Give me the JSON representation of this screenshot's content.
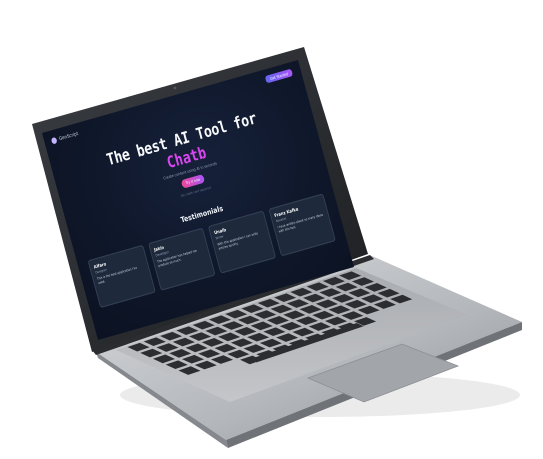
{
  "screen": {
    "nav": {
      "brand": "GenScript",
      "cta_label": "Get Started"
    },
    "hero": {
      "title": "The best AI Tool for",
      "accent": "Chatb",
      "subtitle": "Create content using AI in seconds",
      "button_label": "Try it now",
      "note": "No credit card required"
    },
    "testimonials": {
      "heading": "Testimonials",
      "cards": [
        {
          "name": "Alfaro",
          "role": "Designer",
          "text": "This is the best application I've used."
        },
        {
          "name": "Jakin",
          "role": "Developer",
          "text": "The application has helped me produce so much."
        },
        {
          "name": "Unalb",
          "role": "Writer",
          "text": "With this application I can write articles quickly."
        },
        {
          "name": "Franz Kafka",
          "role": "Novelist",
          "text": "I have written about so many ideas with this tool."
        }
      ]
    }
  },
  "colors": {
    "screen_bg": "#0f172a",
    "accent_pink": "#d946ef",
    "button_gradient": [
      "#ec4899",
      "#a855f7"
    ]
  },
  "icons": [
    "laptop-logo-icon"
  ]
}
